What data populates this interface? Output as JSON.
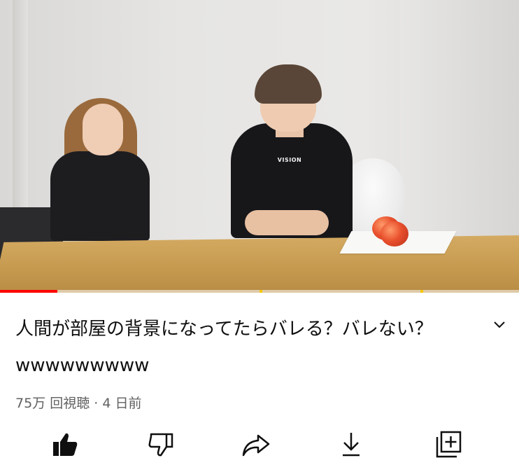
{
  "video": {
    "shirt_print": "VISION",
    "progress_percent": 11
  },
  "info": {
    "title": "人間が部屋の背景になってたらバレる？バレない？wwwwwwwww",
    "views": "75万 回視聴",
    "separator": "·",
    "age": "4 日前"
  },
  "actions": [
    "like-icon",
    "dislike-icon",
    "share-icon",
    "download-icon",
    "save-icon"
  ],
  "colors": {
    "progress": "#ff0000",
    "ad_marker": "#f6c700",
    "title": "#0f0f0f",
    "meta": "#606060"
  }
}
